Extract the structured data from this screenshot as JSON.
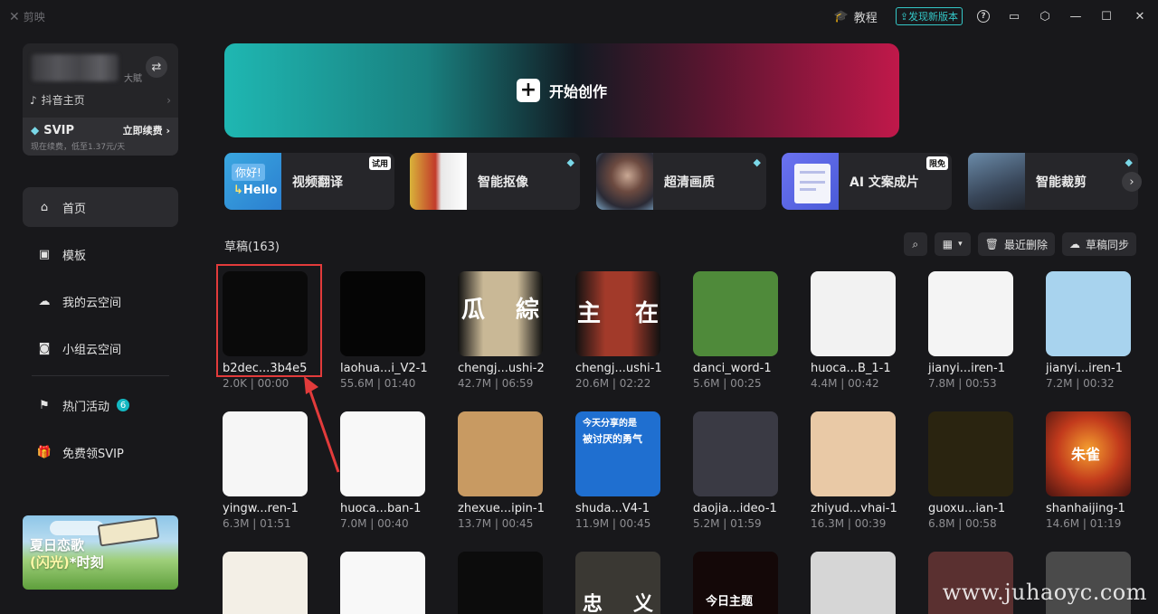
{
  "titlebar": {
    "brand": "剪映",
    "tutorial": "教程",
    "update_badge": "发现新版本"
  },
  "profile": {
    "sub": "大賦",
    "douyin_label": "抖音主页",
    "svip_label": "SVIP",
    "svip_renew": "立即续费",
    "svip_note": "现在续费，低至1.37元/天"
  },
  "nav": [
    {
      "label": "首页",
      "icon": "home-icon"
    },
    {
      "label": "模板",
      "icon": "template-icon"
    },
    {
      "label": "我的云空间",
      "icon": "cloud-icon"
    },
    {
      "label": "小组云空间",
      "icon": "group-cloud-icon"
    },
    {
      "label": "热门活动",
      "icon": "flag-icon",
      "badge": "6"
    },
    {
      "label": "免费领SVIP",
      "icon": "gift-icon"
    }
  ],
  "promo": {
    "line1": "夏日恋歌",
    "line2a": "(闪光)",
    "line2b": "*时刻"
  },
  "hero": {
    "label": "开始创作"
  },
  "tools": [
    {
      "label": "视频翻译",
      "tag": "试用",
      "thumb_text_1": "你好!",
      "thumb_text_2": "Hello"
    },
    {
      "label": "智能抠像"
    },
    {
      "label": "超清画质"
    },
    {
      "label": "AI 文案成片",
      "tag": "限免"
    },
    {
      "label": "智能裁剪"
    }
  ],
  "drafts": {
    "header": "草稿(163)",
    "recent_delete": "最近删除",
    "sync": "草稿同步",
    "items": [
      {
        "name": "b2dec...3b4e5",
        "meta": "2.0K | 00:00",
        "color": "#0a0a0a"
      },
      {
        "name": "laohua...i_V2-1",
        "meta": "55.6M | 01:40",
        "color": "#050505"
      },
      {
        "name": "chengj...ushi-2",
        "meta": "42.7M | 06:59",
        "color": "#d9cdb4"
      },
      {
        "name": "chengj...ushi-1",
        "meta": "20.6M | 02:22",
        "color": "#6b2a24"
      },
      {
        "name": "danci_word-1",
        "meta": "5.6M | 00:25",
        "color": "#4f8a3a"
      },
      {
        "name": "huoca...B_1-1",
        "meta": "4.4M | 00:42",
        "color": "#f2f2f2"
      },
      {
        "name": "jianyi...iren-1",
        "meta": "7.8M | 00:53",
        "color": "#f4f4f4"
      },
      {
        "name": "jianyi...iren-1",
        "meta": "7.2M | 00:32",
        "color": "#a8d3ee"
      },
      {
        "name": "yingw...ren-1",
        "meta": "6.3M | 01:51",
        "color": "#f6f6f6"
      },
      {
        "name": "huoca...ban-1",
        "meta": "7.0M | 00:40",
        "color": "#f8f8f8"
      },
      {
        "name": "zhexue...ipin-1",
        "meta": "13.7M | 00:45",
        "color": "#c89a62"
      },
      {
        "name": "shuda...V4-1",
        "meta": "11.9M | 00:45",
        "color": "#1f6fd0"
      },
      {
        "name": "daojia...ideo-1",
        "meta": "5.2M | 01:59",
        "color": "#3a3a44"
      },
      {
        "name": "zhiyud...vhai-1",
        "meta": "16.3M | 00:39",
        "color": "#e9c9a6"
      },
      {
        "name": "guoxu...ian-1",
        "meta": "6.8M | 00:58",
        "color": "#2a2410"
      },
      {
        "name": "shanhaijing-1",
        "meta": "14.6M | 01:19",
        "color": "#c23a1c"
      },
      {
        "name": "",
        "meta": "",
        "color": "#f3efe6"
      },
      {
        "name": "",
        "meta": "",
        "color": "#f8f8f8"
      },
      {
        "name": "",
        "meta": "",
        "color": "#0c0c0c"
      },
      {
        "name": "",
        "meta": "",
        "color": "#3a3833"
      },
      {
        "name": "",
        "meta": "",
        "color": "#140808"
      },
      {
        "name": "",
        "meta": "",
        "color": "#d6d6d6"
      },
      {
        "name": "",
        "meta": "",
        "color": "#5a3030"
      },
      {
        "name": "",
        "meta": "",
        "color": "#4a4a4a"
      }
    ],
    "thumb_text": {
      "t2_left": "瓜",
      "t2_right": "綜",
      "t3_left": "主",
      "t3_right": "在",
      "t11_top": "今天分享的是",
      "t11_mid": "被讨厌的勇气",
      "t15": "朱雀",
      "t19a": "忠",
      "t19b": "义",
      "t20": "今日主题"
    }
  },
  "watermark": "www.juhaoyc.com"
}
